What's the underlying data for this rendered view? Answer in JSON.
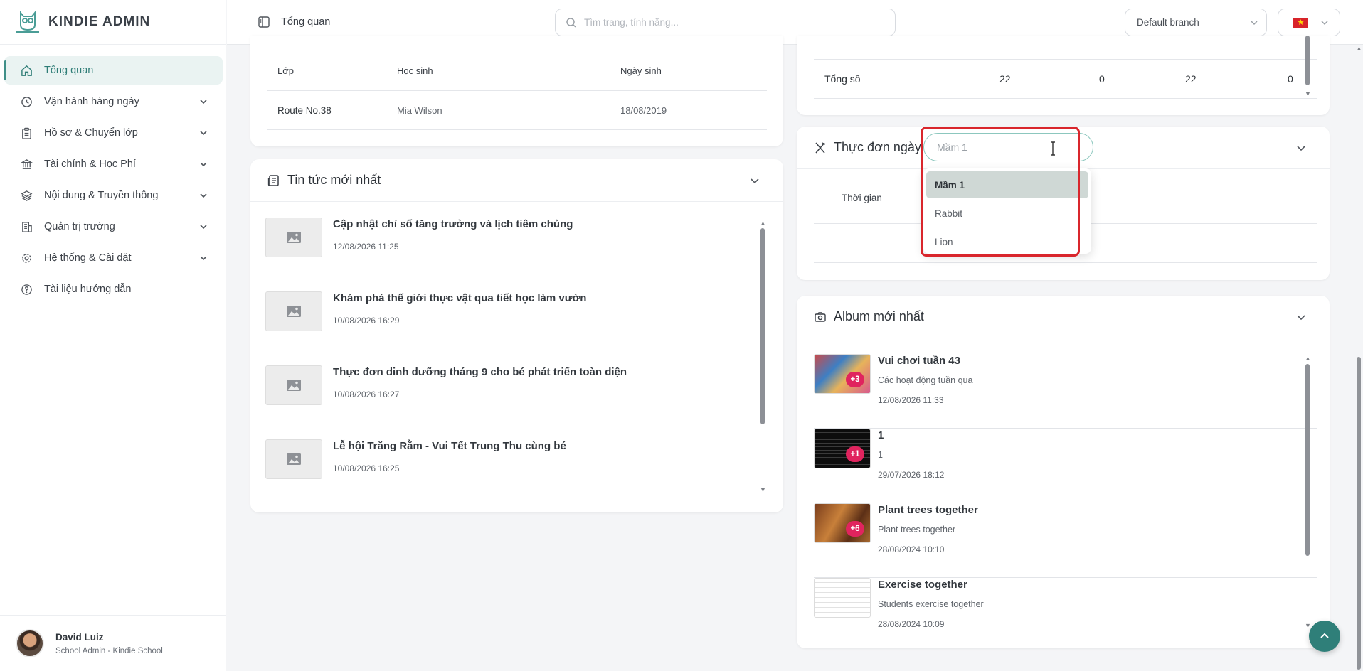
{
  "brand": {
    "name": "KINDIE ADMIN"
  },
  "sidebar": {
    "items": [
      {
        "label": "Tổng quan",
        "icon": "home-icon",
        "active": true
      },
      {
        "label": "Vận hành hàng ngày",
        "icon": "clock-icon"
      },
      {
        "label": "Hồ sơ & Chuyển lớp",
        "icon": "clipboard-icon"
      },
      {
        "label": "Tài chính & Học Phí",
        "icon": "bank-icon"
      },
      {
        "label": "Nội dung & Truyền thông",
        "icon": "layers-icon"
      },
      {
        "label": "Quản trị trường",
        "icon": "building-icon"
      },
      {
        "label": "Hệ thống & Cài đặt",
        "icon": "gear-icon"
      },
      {
        "label": "Tài liệu hướng dẫn",
        "icon": "help-circle-icon"
      }
    ]
  },
  "user": {
    "name": "David Luiz",
    "role": "School Admin - Kindie School"
  },
  "header": {
    "title": "Tổng quan",
    "search_placeholder": "Tìm trang, tính năng...",
    "branch": "Default branch"
  },
  "birthday_table": {
    "headers": [
      "Lớp",
      "Học sinh",
      "Ngày sinh"
    ],
    "rows": [
      {
        "lop": "Route No.38",
        "hoc_sinh": "Mia Wilson",
        "ngay_sinh": "18/08/2019"
      }
    ]
  },
  "news": {
    "title": "Tin tức mới nhất",
    "items": [
      {
        "title": "Cập nhật chỉ số tăng trưởng và lịch tiêm chủng",
        "time": "12/08/2026 11:25"
      },
      {
        "title": "Khám phá thế giới thực vật qua tiết học làm vườn",
        "time": "10/08/2026 16:29"
      },
      {
        "title": "Thực đơn dinh dưỡng tháng 9 cho bé phát triển toàn diện",
        "time": "10/08/2026 16:27"
      },
      {
        "title": "Lễ hội Trăng Rằm - Vui Tết Trung Thu cùng bé",
        "time": "10/08/2026 16:25"
      }
    ]
  },
  "totals": {
    "label": "Tổng số",
    "values": [
      "22",
      "0",
      "22",
      "0"
    ]
  },
  "menu": {
    "title": "Thực đơn ngày",
    "select_placeholder": "Mầm 1",
    "column": "Thời gian",
    "options": [
      "Mầm 1",
      "Rabbit",
      "Lion"
    ]
  },
  "albums": {
    "title": "Album mới nhất",
    "items": [
      {
        "title": "Vui chơi tuần 43",
        "desc": "Các hoạt động tuần qua",
        "time": "12/08/2026 11:33",
        "badge": "+3"
      },
      {
        "title": "1",
        "desc": "1",
        "time": "29/07/2026 18:12",
        "badge": "+1"
      },
      {
        "title": "Plant trees together",
        "desc": "Plant trees together",
        "time": "28/08/2024 10:10",
        "badge": "+6"
      },
      {
        "title": "Exercise together",
        "desc": "Students exercise together",
        "time": "28/08/2024 10:09",
        "badge": ""
      }
    ]
  },
  "colors": {
    "accent": "#2f7f79",
    "highlight": "#d9262c",
    "badge": "#e0245e"
  }
}
